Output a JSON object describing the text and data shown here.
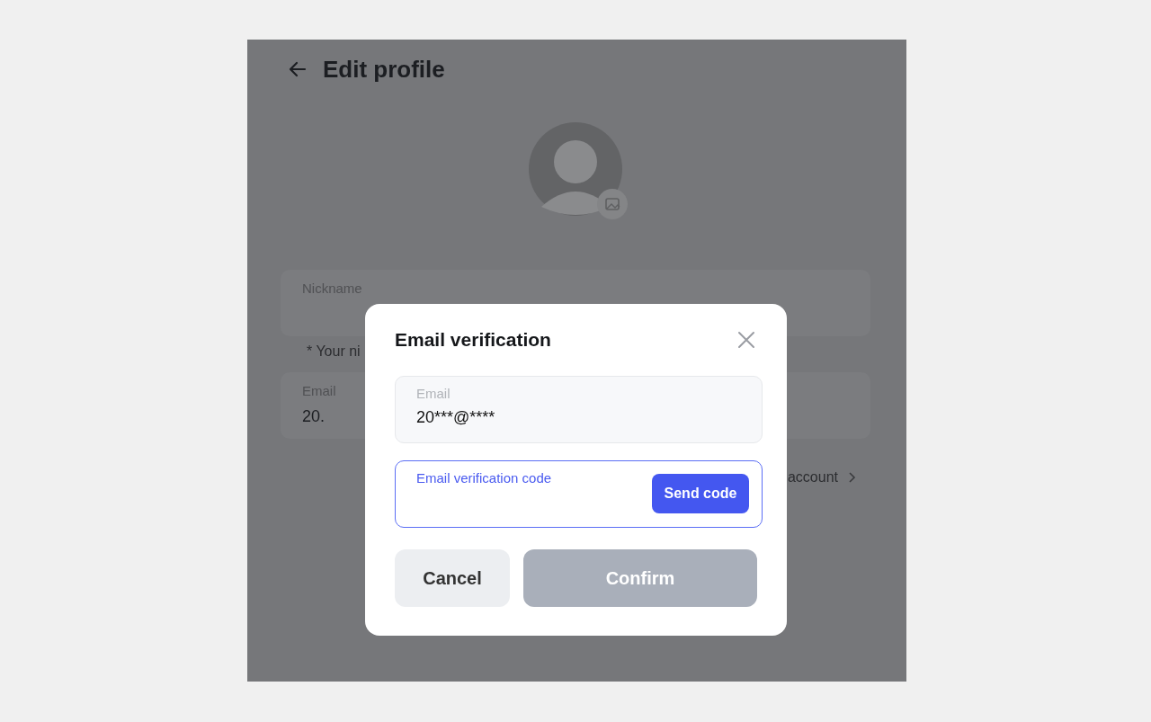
{
  "header": {
    "title": "Edit profile"
  },
  "profile_fields": [
    {
      "label": "Nickname",
      "helper": "* Your ni"
    },
    {
      "label": "Email",
      "value": "20."
    }
  ],
  "account_link": {
    "label": "account"
  },
  "dialog": {
    "title": "Email verification",
    "fields": [
      {
        "kind": "readonly",
        "label": "Email",
        "value": "20***@****",
        "focused": false
      },
      {
        "kind": "code",
        "label": "Email verification code",
        "focused": true,
        "button": "Send code"
      }
    ],
    "buttons": [
      {
        "label": "Cancel",
        "kind": "secondary",
        "disabled": false
      },
      {
        "label": "Confirm",
        "kind": "primary",
        "disabled": true
      }
    ]
  }
}
